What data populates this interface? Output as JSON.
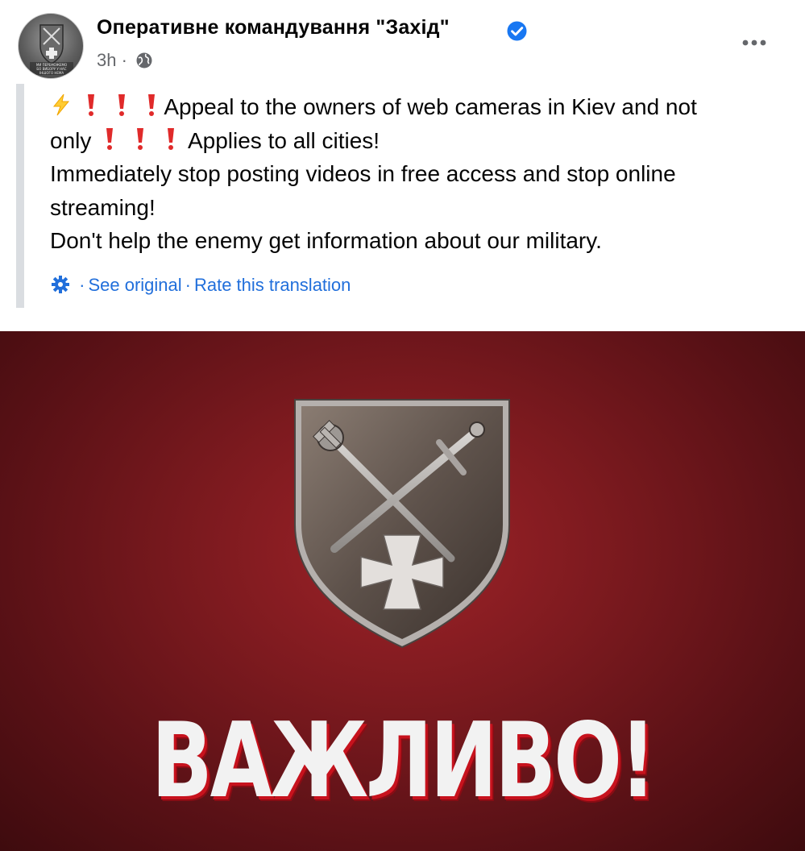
{
  "post": {
    "page_name": "Оперативне командування \"Захід\"",
    "verified_icon": "verified-badge-icon",
    "time": "3h",
    "separator": "·",
    "privacy_icon": "globe-icon",
    "more_icon": "ellipsis-icon"
  },
  "avatar": {
    "motto_lines": [
      "МИ ПЕРЕМОЖЕМО",
      "БО ВИБОРУ У НАС",
      "ІНШОГО НЕМА"
    ]
  },
  "text": {
    "line1": "Appeal to the owners of web cameras in Kiev and not",
    "line2_word": "only",
    "line2_rest": "Applies to all cities!",
    "line3": "Immediately stop posting videos in free access and stop online streaming!",
    "line4": "Don't help the enemy get information about our military.",
    "emoji": [
      "zap-emoji",
      "exclamation-emoji"
    ]
  },
  "translation": {
    "gear_icon": "gear-icon",
    "see_original": "See original",
    "rate": "Rate this translation",
    "sep": "·"
  },
  "image": {
    "caption": "ВАЖЛИВО!",
    "emblem": "shield-emblem-mace-sword-cross"
  },
  "colors": {
    "link": "#216fdb",
    "verified": "#1877f2",
    "image_bg": "#7d1a1f",
    "caption_shadow": "#c7121d"
  }
}
